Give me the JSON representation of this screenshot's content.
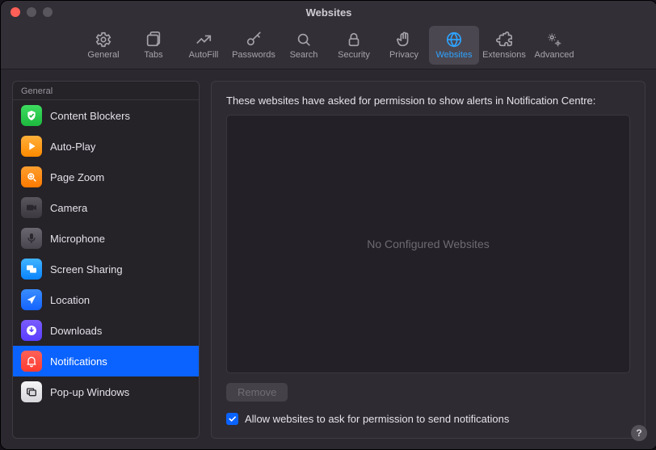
{
  "window": {
    "title": "Websites"
  },
  "tabs": [
    {
      "id": "general",
      "label": "General"
    },
    {
      "id": "tabs",
      "label": "Tabs"
    },
    {
      "id": "autofill",
      "label": "AutoFill"
    },
    {
      "id": "passwords",
      "label": "Passwords"
    },
    {
      "id": "search",
      "label": "Search"
    },
    {
      "id": "security",
      "label": "Security"
    },
    {
      "id": "privacy",
      "label": "Privacy"
    },
    {
      "id": "websites",
      "label": "Websites",
      "active": true
    },
    {
      "id": "extensions",
      "label": "Extensions"
    },
    {
      "id": "advanced",
      "label": "Advanced"
    }
  ],
  "sidebar": {
    "header": "General",
    "items": [
      {
        "id": "content-blockers",
        "label": "Content Blockers"
      },
      {
        "id": "auto-play",
        "label": "Auto-Play"
      },
      {
        "id": "page-zoom",
        "label": "Page Zoom"
      },
      {
        "id": "camera",
        "label": "Camera"
      },
      {
        "id": "microphone",
        "label": "Microphone"
      },
      {
        "id": "screen-sharing",
        "label": "Screen Sharing"
      },
      {
        "id": "location",
        "label": "Location"
      },
      {
        "id": "downloads",
        "label": "Downloads"
      },
      {
        "id": "notifications",
        "label": "Notifications",
        "selected": true
      },
      {
        "id": "popup-windows",
        "label": "Pop-up Windows"
      }
    ]
  },
  "content": {
    "description": "These websites have asked for permission to show alerts in Notification Centre:",
    "empty_text": "No Configured Websites",
    "remove_label": "Remove",
    "remove_enabled": false,
    "checkbox_label": "Allow websites to ask for permission to send notifications",
    "checkbox_checked": true
  },
  "help_tooltip": "?"
}
